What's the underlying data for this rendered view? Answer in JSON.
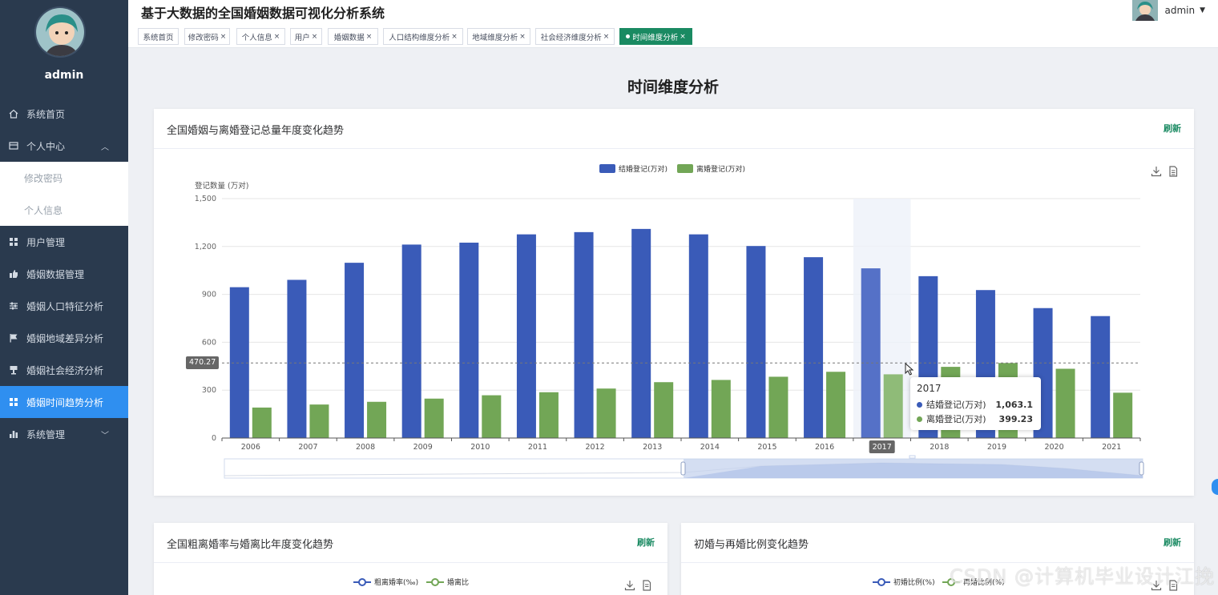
{
  "app": {
    "title": "基于大数据的全国婚姻数据可视化分析系统",
    "user": "admin"
  },
  "sidebar": {
    "username": "admin",
    "items": [
      {
        "label": "系统首页",
        "icon": "home-icon"
      },
      {
        "label": "个人中心",
        "icon": "user-card-icon",
        "expanded": true
      },
      {
        "label": "修改密码",
        "sub": true
      },
      {
        "label": "个人信息",
        "sub": true
      },
      {
        "label": "用户管理",
        "icon": "grid-icon"
      },
      {
        "label": "婚姻数据管理",
        "icon": "thumb-icon"
      },
      {
        "label": "婚姻人口特征分析",
        "icon": "sliders-icon"
      },
      {
        "label": "婚姻地域差异分析",
        "icon": "flag-icon"
      },
      {
        "label": "婚姻社会经济分析",
        "icon": "chalice-icon"
      },
      {
        "label": "婚姻时间趋势分析",
        "icon": "grid-icon",
        "active": true
      },
      {
        "label": "系统管理",
        "icon": "bar-icon"
      }
    ]
  },
  "tabs": [
    {
      "label": "系统首页",
      "closable": false
    },
    {
      "label": "修改密码",
      "closable": true
    },
    {
      "label": "个人信息",
      "closable": true
    },
    {
      "label": "用户",
      "closable": true
    },
    {
      "label": "婚姻数据",
      "closable": true
    },
    {
      "label": "人口结构维度分析",
      "closable": true
    },
    {
      "label": "地域维度分析",
      "closable": true
    },
    {
      "label": "社会经济维度分析",
      "closable": true
    },
    {
      "label": "时间维度分析",
      "closable": true,
      "active": true
    }
  ],
  "tab_close": "×",
  "page_title": "时间维度分析",
  "cards": {
    "main": {
      "title": "全国婚姻与离婚登记总量年度变化趋势",
      "refresh": "刷新"
    },
    "left": {
      "title": "全国粗离婚率与婚离比年度变化趋势",
      "refresh": "刷新",
      "legend": [
        "粗离婚率(‰)",
        "婚离比"
      ]
    },
    "right": {
      "title": "初婚与再婚比例变化趋势",
      "refresh": "刷新",
      "legend": [
        "初婚比例(%)",
        "再婚比例(%)"
      ]
    }
  },
  "chart_data": {
    "type": "bar",
    "ylabel": "登记数量 (万对)",
    "ylim": [
      0,
      1500
    ],
    "yticks": [
      0,
      300,
      600,
      900,
      1200,
      1500
    ],
    "ytick_labels": [
      "0",
      "300",
      "600",
      "900",
      "1,200",
      "1,500"
    ],
    "categories": [
      "2006",
      "2007",
      "2008",
      "2009",
      "2010",
      "2011",
      "2012",
      "2013",
      "2014",
      "2015",
      "2016",
      "2017",
      "2018",
      "2019",
      "2020",
      "2021"
    ],
    "series": [
      {
        "name": "结婚登记(万对)",
        "color": "#3a5bb8",
        "values": [
          945,
          991,
          1098,
          1212,
          1224,
          1276,
          1290,
          1310,
          1276,
          1203,
          1133,
          1063.1,
          1014,
          927,
          814,
          764
        ]
      },
      {
        "name": "离婚登记(万对)",
        "color": "#72a656",
        "values": [
          191,
          210,
          227,
          247,
          268,
          287,
          310,
          350,
          364,
          384,
          415,
          399.23,
          446,
          470,
          434,
          284
        ]
      }
    ],
    "legend_position": "top-center",
    "highlight_category": "2017",
    "axis_pointer_value": "470.27",
    "tooltip": {
      "title": "2017",
      "rows": [
        {
          "name": "结婚登记(万对)",
          "value": "1,063.1"
        },
        {
          "name": "离婚登记(万对)",
          "value": "399.23"
        }
      ]
    },
    "colors": {
      "marriage": "#3a5bb8",
      "divorce": "#72a656",
      "crude_rate": "#3a5bb8",
      "ratio": "#72a656"
    }
  },
  "watermark": "CSDN @计算机毕业设计江挽"
}
